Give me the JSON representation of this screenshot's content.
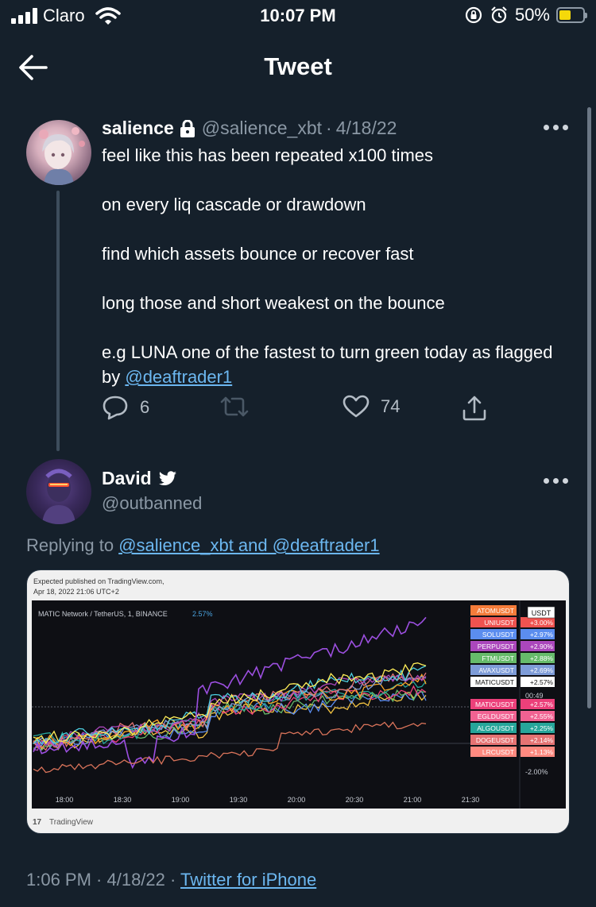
{
  "status_bar": {
    "carrier": "Claro",
    "time": "10:07 PM",
    "battery_percent": "50%",
    "battery_level": 0.5
  },
  "header": {
    "title": "Tweet"
  },
  "tweet": {
    "name": "salience",
    "handle": "@salience_xbt",
    "separator": "·",
    "date": "4/18/22",
    "body": [
      "feel like this has been repeated x100 times",
      "on every liq cascade or drawdown",
      "find which assets bounce or recover fast",
      "long those and short weakest on the bounce"
    ],
    "last_line_text": "e.g LUNA one of the fastest to turn green today as flagged by ",
    "mention": "@deaftrader1",
    "reply_count": "6",
    "like_count": "74"
  },
  "reply": {
    "name": "David",
    "handle": "@outbanned",
    "replying_label": "Replying to ",
    "replying_mentions": "@salience_xbt and @deaftrader1",
    "timestamp": "1:06 PM · 4/18/22 · ",
    "source": "Twitter for iPhone"
  },
  "chart": {
    "published_line1": "Expected published on TradingView.com,",
    "published_line2": "Apr 18, 2022 21:06 UTC+2",
    "symbol_title": "MATIC Network / TetherUS, 1, BINANCE",
    "symbol_change": "2.57%",
    "currency_badge": "USDT",
    "countdown": "00:49",
    "scale_label": "-2.00%",
    "watermark": "TradingView",
    "x_ticks": [
      "18:00",
      "18:30",
      "19:00",
      "19:30",
      "20:00",
      "20:30",
      "21:00",
      "21:30"
    ],
    "labels": [
      {
        "name": "ATOMUSDT",
        "value": "",
        "color": "#f57c3a"
      },
      {
        "name": "UNIUSDT",
        "value": "+3.00%",
        "color": "#ef5350"
      },
      {
        "name": "SOLUSDT",
        "value": "+2.97%",
        "color": "#5b8def"
      },
      {
        "name": "PERPUSDT",
        "value": "+2.90%",
        "color": "#ab47bc"
      },
      {
        "name": "FTMUSDT",
        "value": "+2.88%",
        "color": "#66bb6a"
      },
      {
        "name": "AVAXUSDT",
        "value": "+2.69%",
        "color": "#7e9cd8"
      },
      {
        "name": "MATICUSDT",
        "value": "+2.57%",
        "color": "#ffffff"
      },
      {
        "name": "MATICUSDT",
        "value": "+2.57%",
        "color": "#ec407a"
      },
      {
        "name": "EGLDUSDT",
        "value": "+2.55%",
        "color": "#f06292"
      },
      {
        "name": "ALGOUSDT",
        "value": "+2.25%",
        "color": "#26a69a"
      },
      {
        "name": "DOGEUSDT",
        "value": "+2.14%",
        "color": "#e57373"
      },
      {
        "name": "LRCUSDT",
        "value": "+1.13%",
        "color": "#ff8a80"
      }
    ]
  }
}
